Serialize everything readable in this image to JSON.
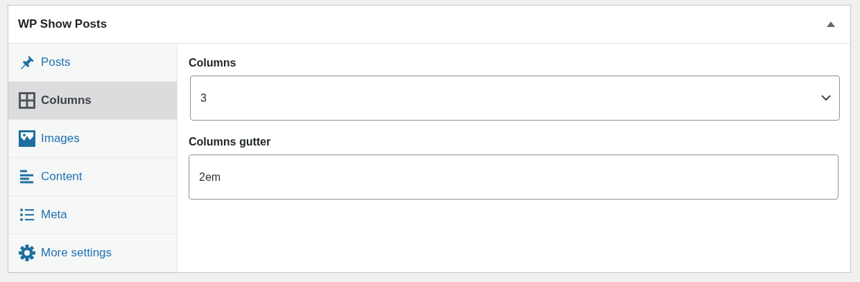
{
  "panel": {
    "title": "WP Show Posts",
    "expanded": true
  },
  "tabs": [
    {
      "label": "Posts",
      "selected": false
    },
    {
      "label": "Columns",
      "selected": true
    },
    {
      "label": "Images",
      "selected": false
    },
    {
      "label": "Content",
      "selected": false
    },
    {
      "label": "Meta",
      "selected": false
    },
    {
      "label": "More settings",
      "selected": false
    }
  ],
  "fields": [
    {
      "kind": "select",
      "label": "Columns",
      "value": "3"
    },
    {
      "kind": "text",
      "label": "Columns gutter",
      "value": "2em"
    }
  ]
}
